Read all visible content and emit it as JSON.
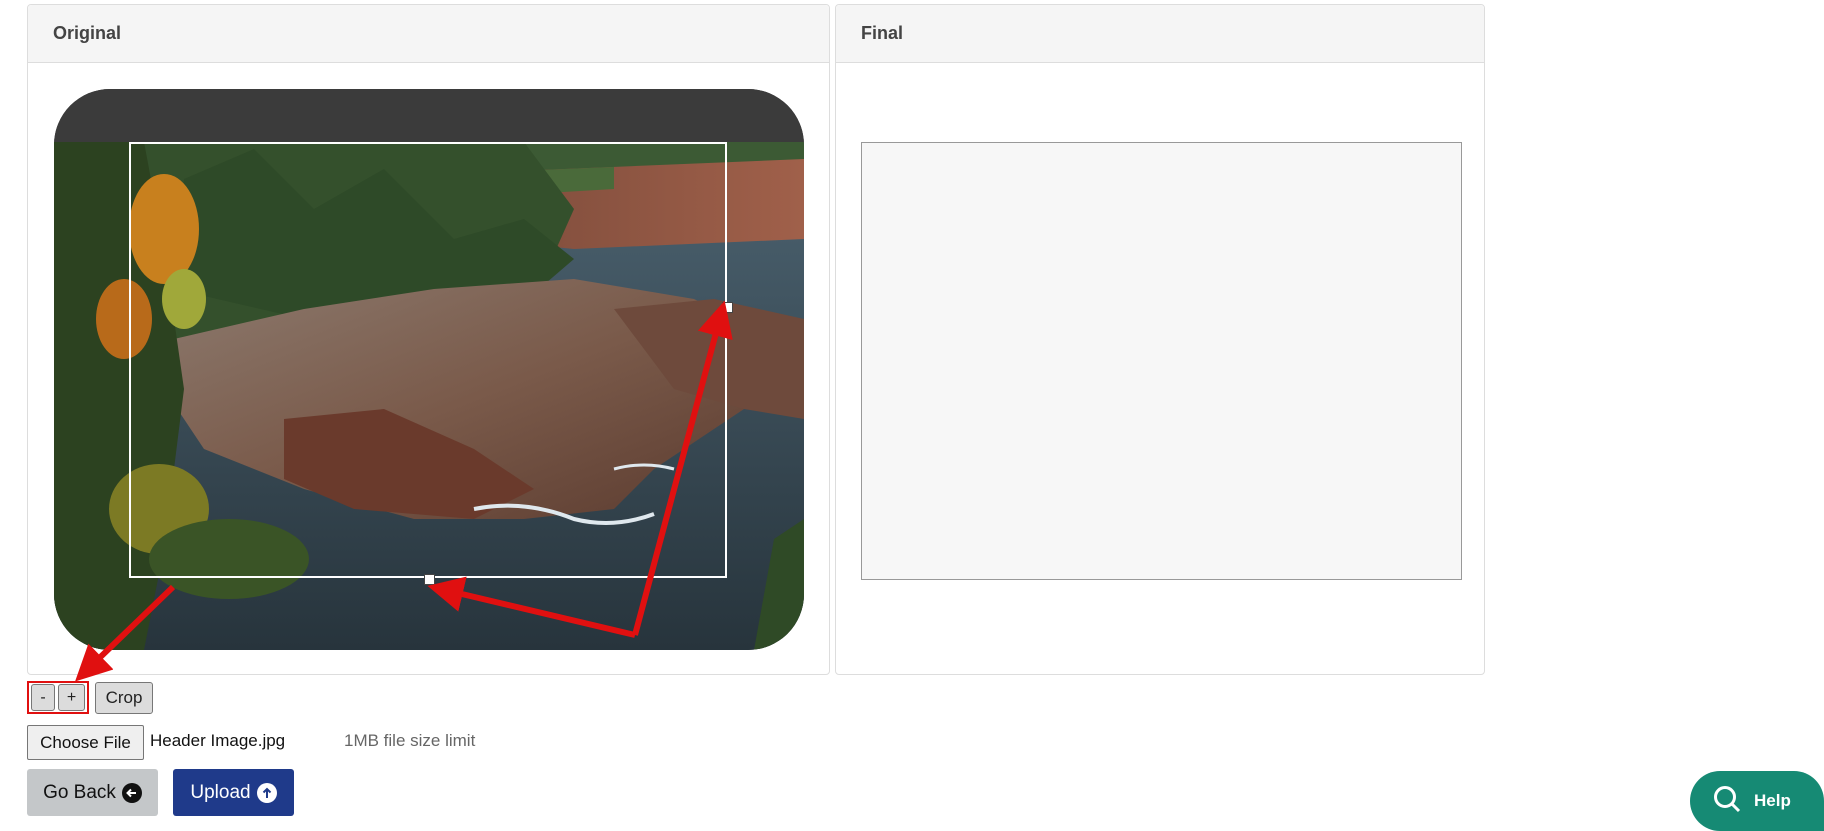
{
  "panels": {
    "original_title": "Original",
    "final_title": "Final"
  },
  "crop_controls": {
    "zoom_out_label": "-",
    "zoom_in_label": "+",
    "crop_label": "Crop"
  },
  "file_input": {
    "button_label": "Choose File",
    "file_name": "Header Image.jpg",
    "size_limit": "1MB file size limit"
  },
  "actions": {
    "go_back_label": "Go Back",
    "upload_label": "Upload"
  },
  "help": {
    "label": "Help"
  },
  "colors": {
    "annotation_red": "#e01010",
    "upload_blue": "#1f3a8a",
    "help_green": "#168a74"
  },
  "icons": [
    "arrow-left-circle-icon",
    "arrow-up-circle-icon",
    "search-icon"
  ]
}
